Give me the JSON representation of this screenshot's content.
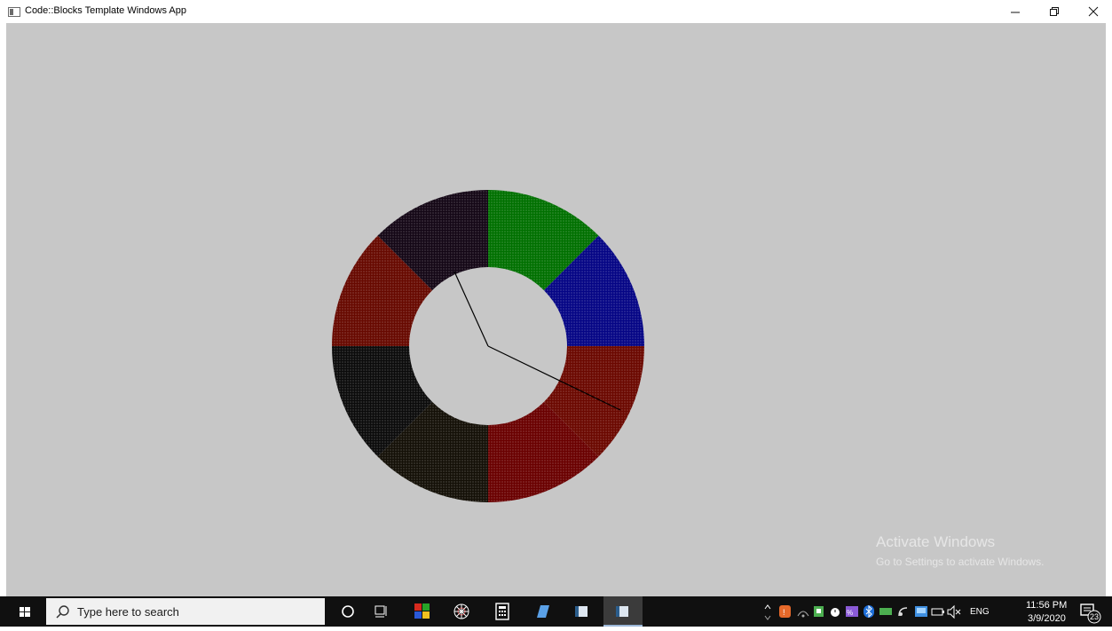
{
  "window": {
    "title": "Code::Blocks Template Windows App",
    "controls": [
      "minimize",
      "maximize",
      "close"
    ]
  },
  "canvas": {
    "background": "#c7c7c7",
    "ring_segments": [
      {
        "color": "#007000",
        "name": "green"
      },
      {
        "color": "#050585",
        "name": "blue"
      },
      {
        "color": "#6b0800",
        "name": "red-right"
      },
      {
        "color": "#6a0000",
        "name": "red-bottom"
      },
      {
        "color": "#141007",
        "name": "dark-olive"
      },
      {
        "color": "#0b0b0b",
        "name": "black"
      },
      {
        "color": "#670900",
        "name": "red-left"
      },
      {
        "color": "#140716",
        "name": "dark-purple"
      }
    ]
  },
  "watermark": {
    "title": "Activate Windows",
    "subtitle": "Go to Settings to activate Windows."
  },
  "taskbar": {
    "search_placeholder": "Type here to search",
    "language": "ENG",
    "time": "11:56 PM",
    "date": "3/9/2020",
    "notification_count": "23",
    "pinned_apps": [
      "cortana-circle",
      "task-view",
      "colored-tiles-app",
      "spider-web-app",
      "calculator",
      "notepad-app",
      "window-app-1",
      "window-app-active"
    ]
  }
}
